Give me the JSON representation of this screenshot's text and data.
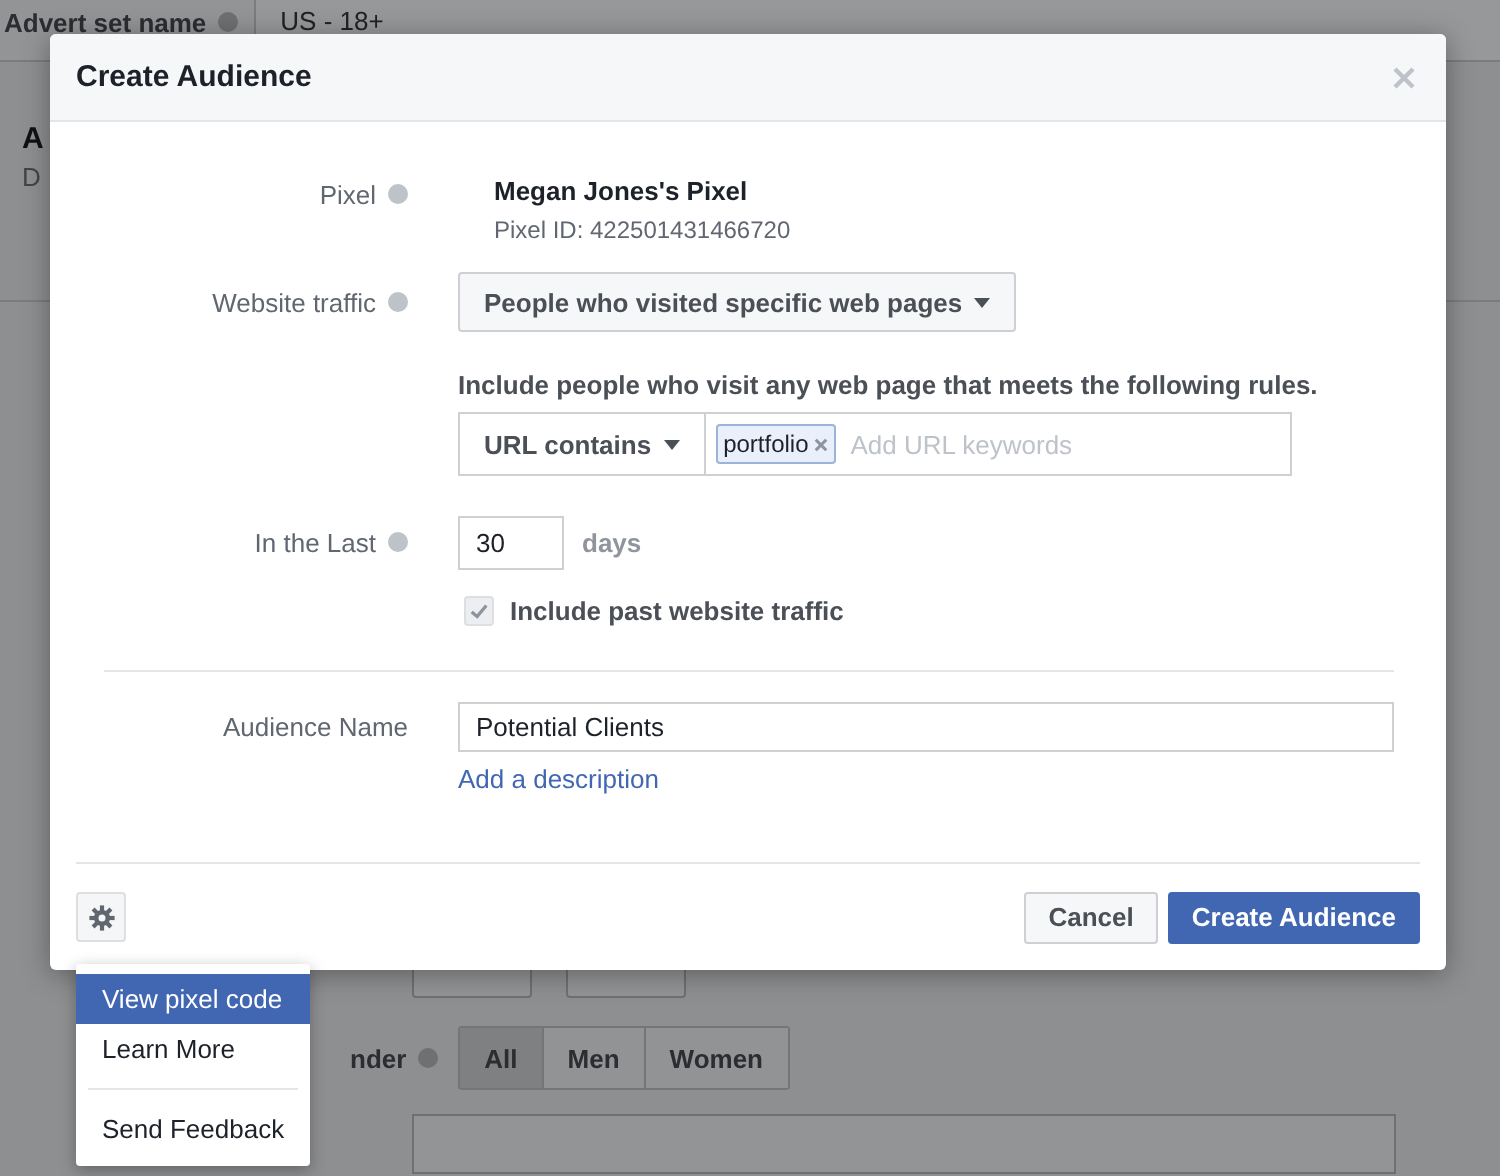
{
  "background_page": {
    "advert_set_label": "Advert set name",
    "advert_set_value": "US - 18+",
    "section_title": "A",
    "section_subtitle": "D",
    "gender_label": "nder",
    "gender_options": [
      {
        "label": "All",
        "selected": true
      },
      {
        "label": "Men",
        "selected": false
      },
      {
        "label": "Women",
        "selected": false
      }
    ]
  },
  "dialog": {
    "title": "Create Audience",
    "pixel": {
      "label": "Pixel",
      "name": "Megan Jones's Pixel",
      "id": "Pixel ID: 422501431466720"
    },
    "website_traffic": {
      "label": "Website traffic",
      "value": "People who visited specific web pages"
    },
    "rules": {
      "heading": "Include people who visit any web page that meets the following rules.",
      "condition": "URL contains",
      "keywords": [
        "portfolio"
      ],
      "placeholder": "Add URL keywords"
    },
    "in_the_last": {
      "label": "In the Last",
      "value": "30",
      "unit": "days"
    },
    "include_past": {
      "label": "Include past website traffic",
      "checked": true
    },
    "audience_name": {
      "label": "Audience Name",
      "value": "Potential Clients",
      "link": "Add a description"
    },
    "buttons": {
      "cancel": "Cancel",
      "create": "Create Audience"
    }
  },
  "settings_menu": {
    "items": [
      {
        "kind": "item",
        "label": "View pixel code",
        "selected": true
      },
      {
        "kind": "item",
        "label": "Learn More",
        "selected": false
      },
      {
        "kind": "divider"
      },
      {
        "kind": "item",
        "label": "Send Feedback",
        "selected": false
      }
    ]
  }
}
